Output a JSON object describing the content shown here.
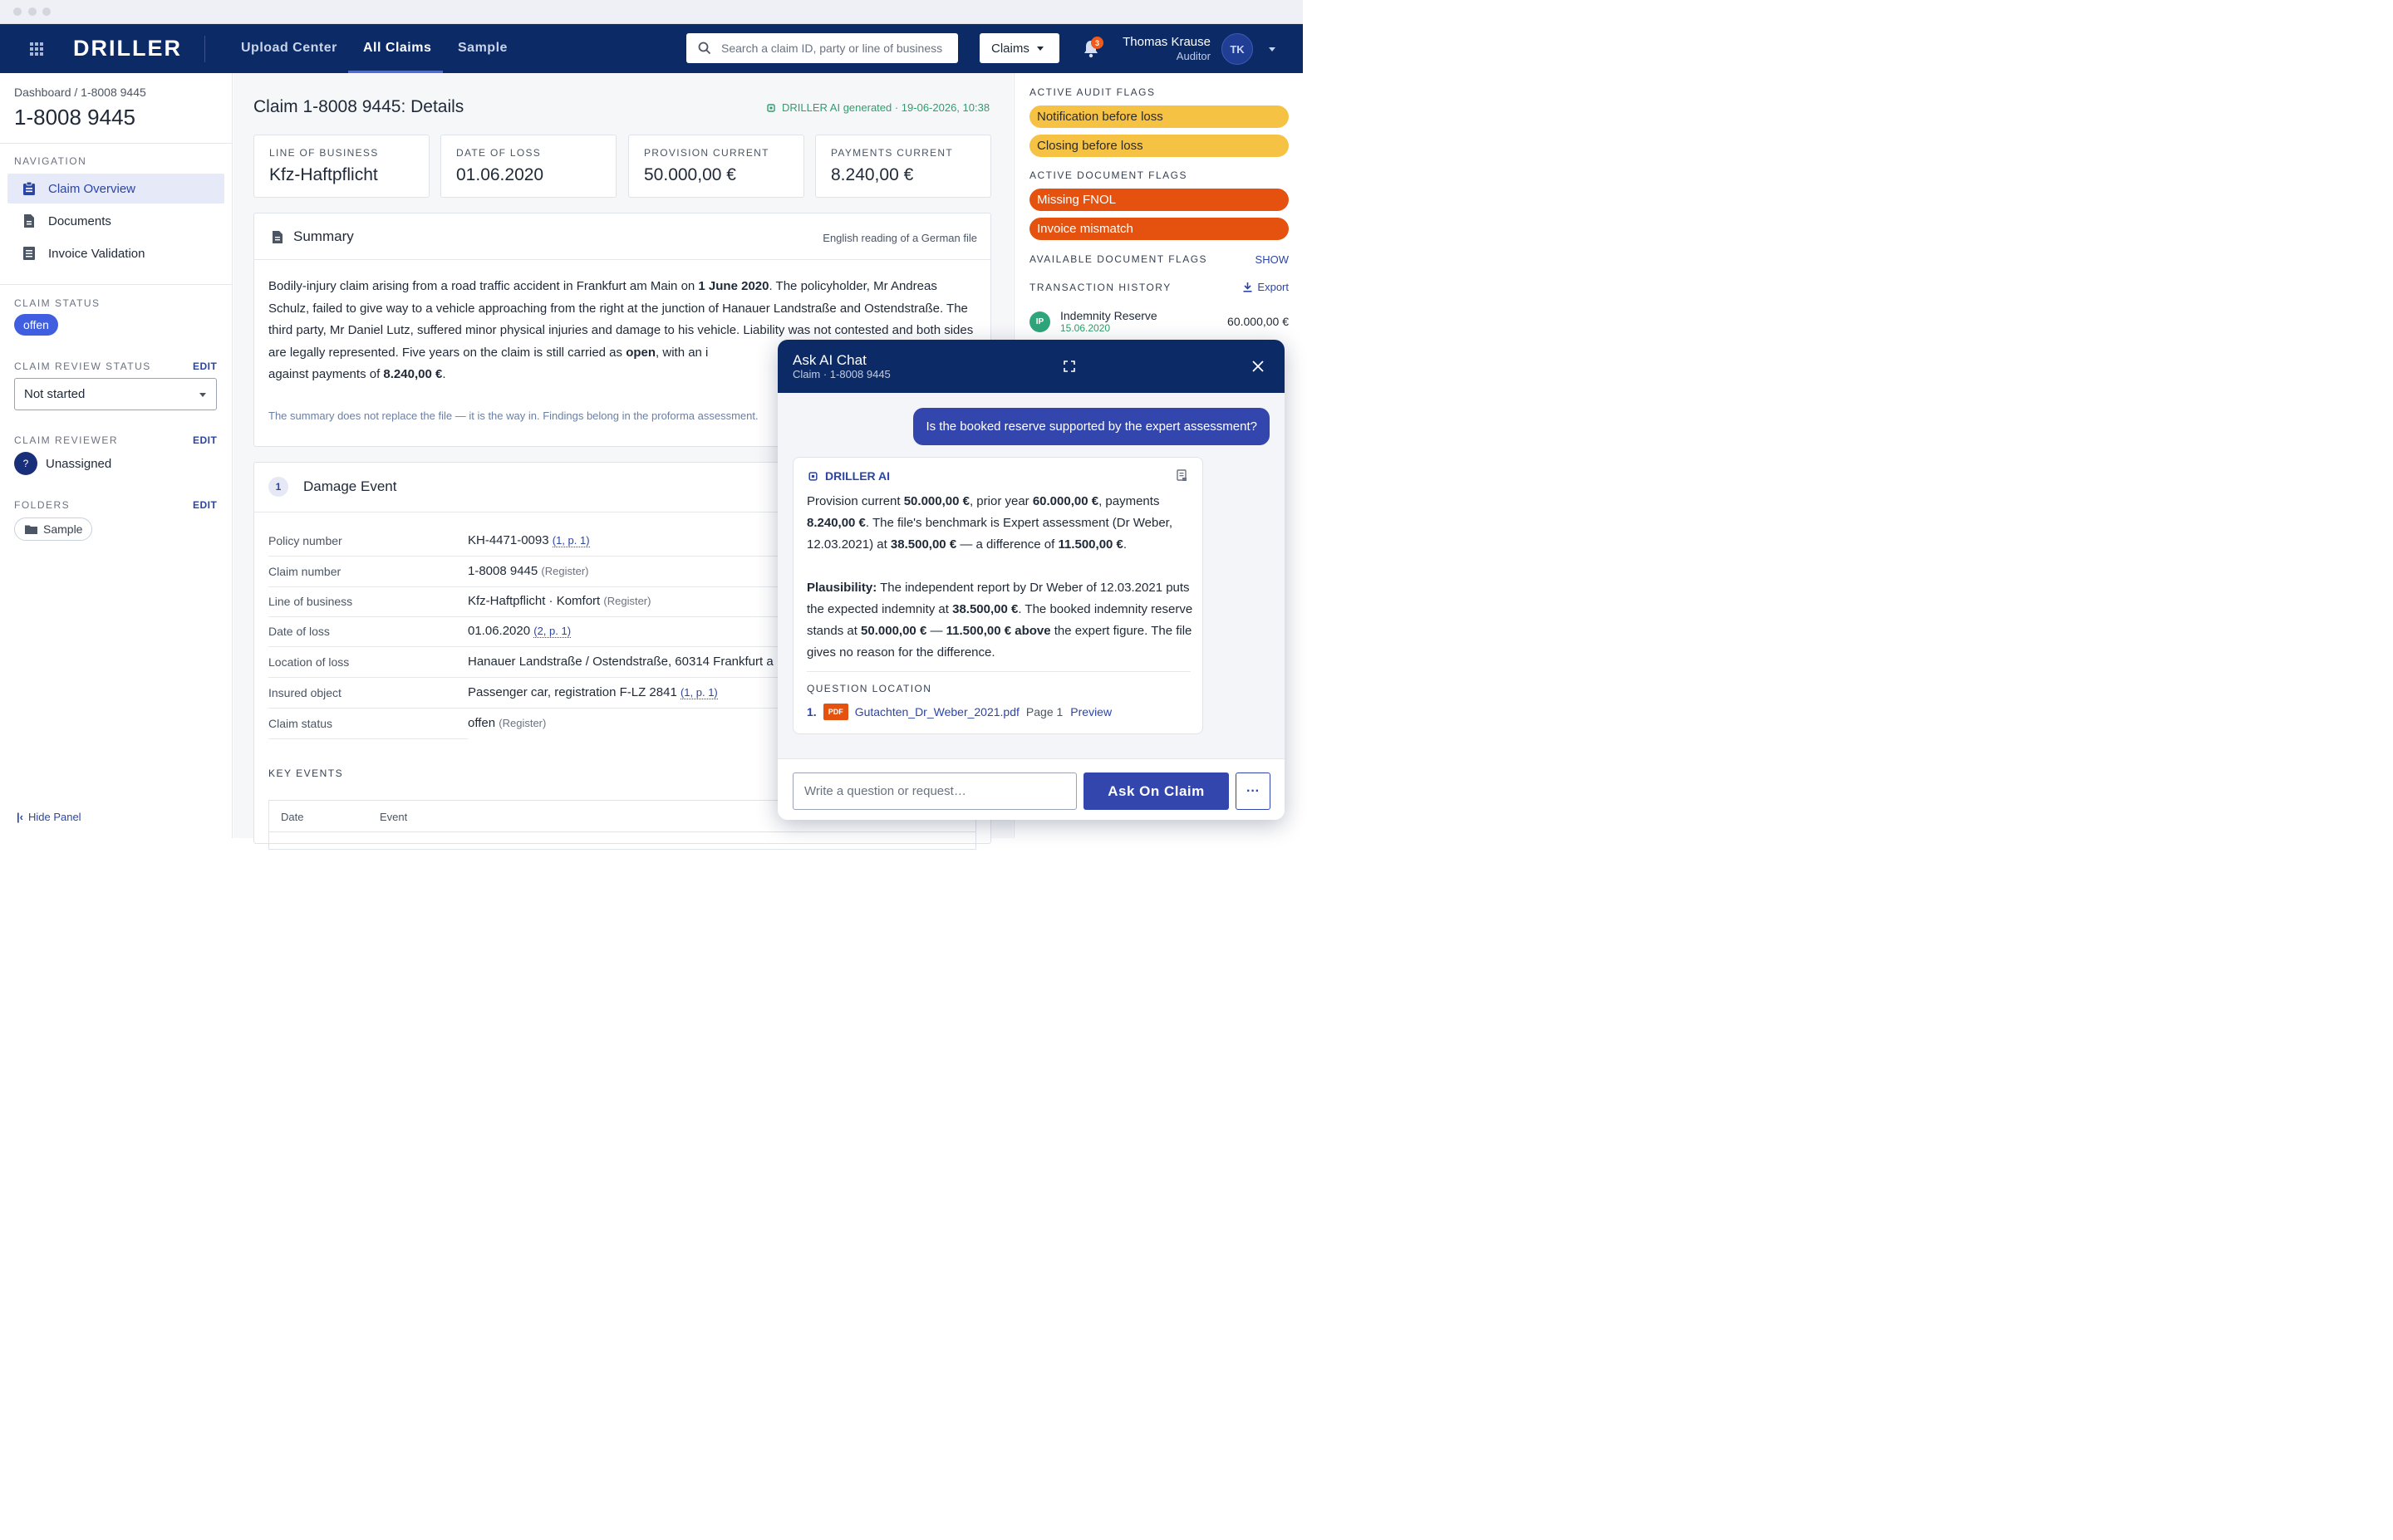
{
  "topnav": {
    "logo": "DRILLER",
    "items": [
      "Upload Center",
      "All Claims",
      "Sample"
    ],
    "search_placeholder": "Search a claim ID, party or line of business",
    "claims_dropdown": "Claims",
    "notification_count": "3",
    "user": {
      "name": "Thomas Krause",
      "role": "Auditor",
      "initials": "TK"
    }
  },
  "sidebar": {
    "breadcrumb": "Dashboard / 1-8008 9445",
    "claim_id": "1-8008 9445",
    "nav_heading": "NAVIGATION",
    "nav": [
      "Claim Overview",
      "Documents",
      "Invoice Validation"
    ],
    "status_heading": "CLAIM STATUS",
    "status": "offen",
    "review_heading": "CLAIM REVIEW STATUS",
    "review_status": "Not started",
    "reviewer_heading": "CLAIM REVIEWER",
    "reviewer_avatar": "?",
    "reviewer": "Unassigned",
    "folders_heading": "FOLDERS",
    "folder": "Sample",
    "edit_label": "EDIT",
    "hide_panel": "Hide Panel"
  },
  "main": {
    "title": "Claim 1-8008 9445: Details",
    "ai_generated": "DRILLER AI generated · 19-06-2026, 10:38",
    "kpis": [
      {
        "label": "LINE OF BUSINESS",
        "value": "Kfz-Haftpflicht"
      },
      {
        "label": "DATE OF LOSS",
        "value": "01.06.2020"
      },
      {
        "label": "PROVISION CURRENT",
        "value": "50.000,00 €"
      },
      {
        "label": "PAYMENTS CURRENT",
        "value": "8.240,00 €"
      }
    ],
    "summary": {
      "title": "Summary",
      "note": "English reading of a German file",
      "t1": "Bodily-injury claim arising from a road traffic accident in Frankfurt am Main on ",
      "b1": "1 June 2020",
      "t2": ". The policyholder, Mr Andreas Schulz, failed to give way to a vehicle approaching from the right at the junction of Hanauer Landstraße and Ostendstraße. The third party, Mr Daniel Lutz, suffered minor physical injuries and damage to his vehicle. Liability was not contested and both sides are legally represented. Five years on the claim is still carried as ",
      "b2": "open",
      "t3": ", with an i",
      "t4": "against payments of ",
      "b3": "8.240,00 €",
      "t5": ".",
      "footnote": "The summary does not replace the file — it is the way in. Findings belong in the proforma assessment."
    },
    "damage": {
      "num": "1",
      "title": "Damage Event",
      "rows": [
        {
          "k": "Policy number",
          "v": "KH-4471-0093",
          "ref": "(1, p. 1)",
          "reg": ""
        },
        {
          "k": "Claim number",
          "v": "1-8008 9445",
          "ref": "",
          "reg": "(Register)"
        },
        {
          "k": "Line of business",
          "v": "Kfz-Haftpflicht · Komfort",
          "ref": "",
          "reg": "(Register)"
        },
        {
          "k": "Date of loss",
          "v": "01.06.2020",
          "ref": "(2, p. 1)",
          "reg": ""
        },
        {
          "k": "Location of loss",
          "v": "Hanauer Landstraße / Ostendstraße, 60314 Frankfurt a",
          "ref": "",
          "reg": ""
        },
        {
          "k": "Insured object",
          "v": "Passenger car, registration F-LZ 2841",
          "ref": "(1, p. 1)",
          "reg": ""
        },
        {
          "k": "Claim status",
          "v": "offen",
          "ref": "",
          "reg": "(Register)"
        }
      ],
      "key_events": "KEY EVENTS",
      "cols": [
        "Date",
        "Event"
      ]
    }
  },
  "right": {
    "audit_heading": "ACTIVE AUDIT FLAGS",
    "audit_flags": [
      "Notification before loss",
      "Closing before loss"
    ],
    "doc_heading": "ACTIVE DOCUMENT FLAGS",
    "doc_flags": [
      "Missing FNOL",
      "Invoice mismatch"
    ],
    "available_heading": "AVAILABLE DOCUMENT FLAGS",
    "show": "SHOW",
    "tx_heading": "TRANSACTION HISTORY",
    "export": "Export",
    "tx": {
      "initials": "IP",
      "name": "Indemnity Reserve",
      "date": "15.06.2020",
      "amount": "60.000,00 €"
    }
  },
  "chat": {
    "title": "Ask AI Chat",
    "subtitle": "Claim · 1-8008 9445",
    "user_message": "Is the booked reserve supported by the expert assessment?",
    "ai_name": "DRILLER AI",
    "p1": [
      "Provision current ",
      "50.000,00 €",
      ", prior year ",
      "60.000,00 €",
      ", payments ",
      "8.240,00 €",
      ". The file's benchmark is Expert assessment (Dr Weber, 12.03.2021) at ",
      "38.500,00 €",
      " — a difference of ",
      "11.500,00 €",
      "."
    ],
    "p2": [
      "Plausibility:",
      " The independent report by Dr Weber of 12.03.2021 puts the expected indemnity at ",
      "38.500,00 €",
      ". The booked indemnity reserve stands at ",
      "50.000,00 €",
      " — ",
      "11.500,00 € above",
      " the expert figure. The file gives no reason for the difference."
    ],
    "location_heading": "QUESTION LOCATION",
    "source": {
      "index": "1.",
      "type": "PDF",
      "file": "Gutachten_Dr_Weber_2021.pdf",
      "page": "Page 1",
      "preview": "Preview"
    },
    "input_placeholder": "Write a question or request…",
    "ask_button": "Ask On Claim",
    "more": "···"
  }
}
